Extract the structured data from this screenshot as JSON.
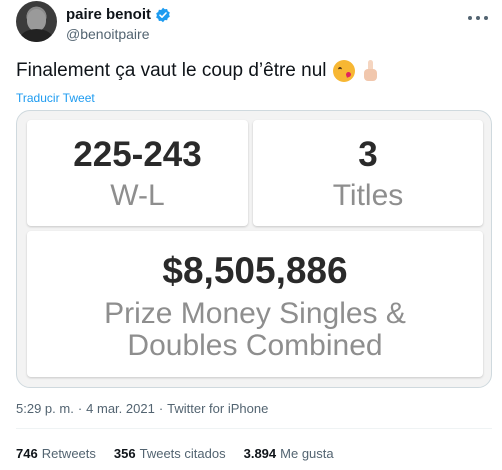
{
  "author": {
    "display_name": "paire benoit",
    "handle": "@benoitpaire",
    "verified_color": "#1d9bf0"
  },
  "tweet": {
    "text": "Finalement ça vaut le coup d’être nul",
    "emojis": [
      "face-blowing-kiss-icon",
      "middle-finger-icon"
    ],
    "translate_label": "Traducir Tweet"
  },
  "card": {
    "wl": {
      "value": "225-243",
      "label": "W-L"
    },
    "titles": {
      "value": "3",
      "label": "Titles"
    },
    "prize": {
      "value": "$8,505,886",
      "label": "Prize Money Singles & Doubles Combined"
    }
  },
  "meta": {
    "time": "5:29 p. m.",
    "separator": "·",
    "date": "4 mar. 2021",
    "source": "Twitter for iPhone"
  },
  "engagement": {
    "retweets_count": "746",
    "retweets_label": "Retweets",
    "quotes_count": "356",
    "quotes_label": "Tweets citados",
    "likes_count": "3.894",
    "likes_label": "Me gusta"
  },
  "colors": {
    "link": "#1d9bf0",
    "secondary_text": "#536471",
    "primary_text": "#0f1419"
  }
}
